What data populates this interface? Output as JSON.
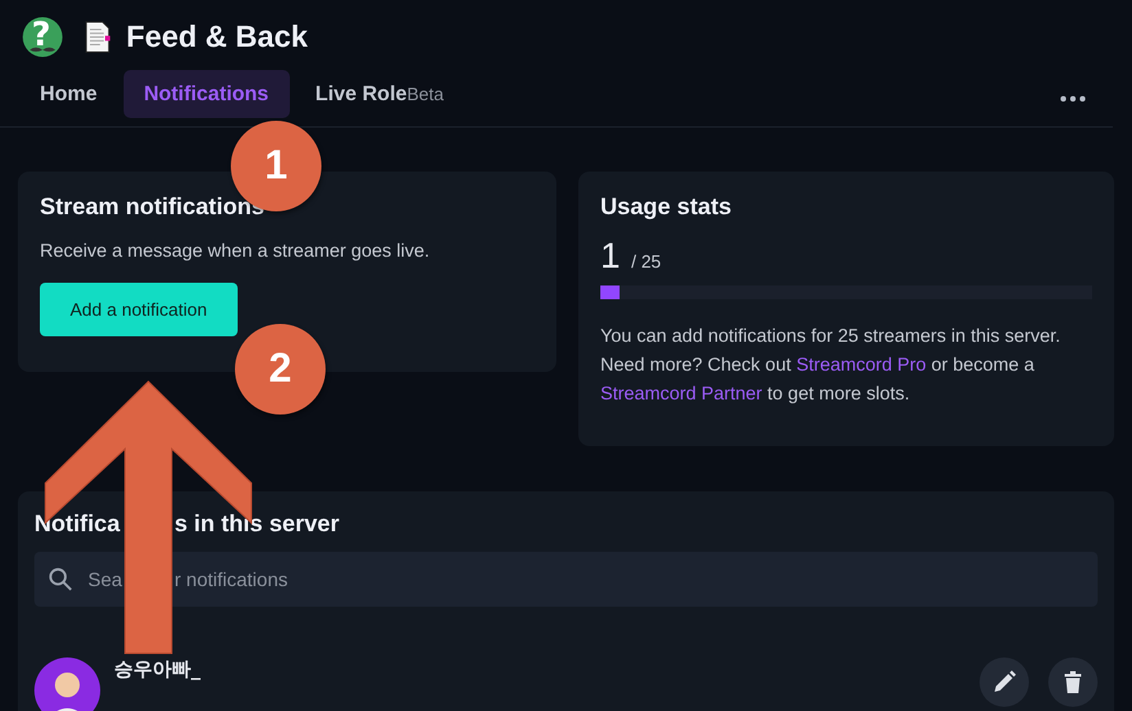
{
  "header": {
    "logo_glyph": "?",
    "title": "Feed & Back"
  },
  "tabs": [
    {
      "label": "Home",
      "selected": false
    },
    {
      "label": "Notifications",
      "selected": true
    },
    {
      "label": "Live Role",
      "badge": "Beta",
      "selected": false
    }
  ],
  "stream_card": {
    "title": "Stream notifications",
    "description": "Receive a message when a streamer goes live.",
    "button": "Add a notification"
  },
  "usage_card": {
    "title": "Usage stats",
    "count": "1",
    "limit": "/ 25",
    "level": 0.04,
    "text_before": "You can add notifications for 25 streamers in this server. Need more? Check out ",
    "link_1": "Streamcord Pro",
    "text_middle": " or become a ",
    "link_2": "Streamcord Partner",
    "text_after": " to get more slots."
  },
  "list_card": {
    "title_parts": [
      "Notifica",
      "s in this server"
    ],
    "search": {
      "placeholder": [
        "Sea",
        "r notifications"
      ]
    },
    "items": [
      {
        "name": "승우아빠_"
      }
    ]
  },
  "annotations": [
    {
      "label": "1"
    },
    {
      "label": "2"
    }
  ]
}
